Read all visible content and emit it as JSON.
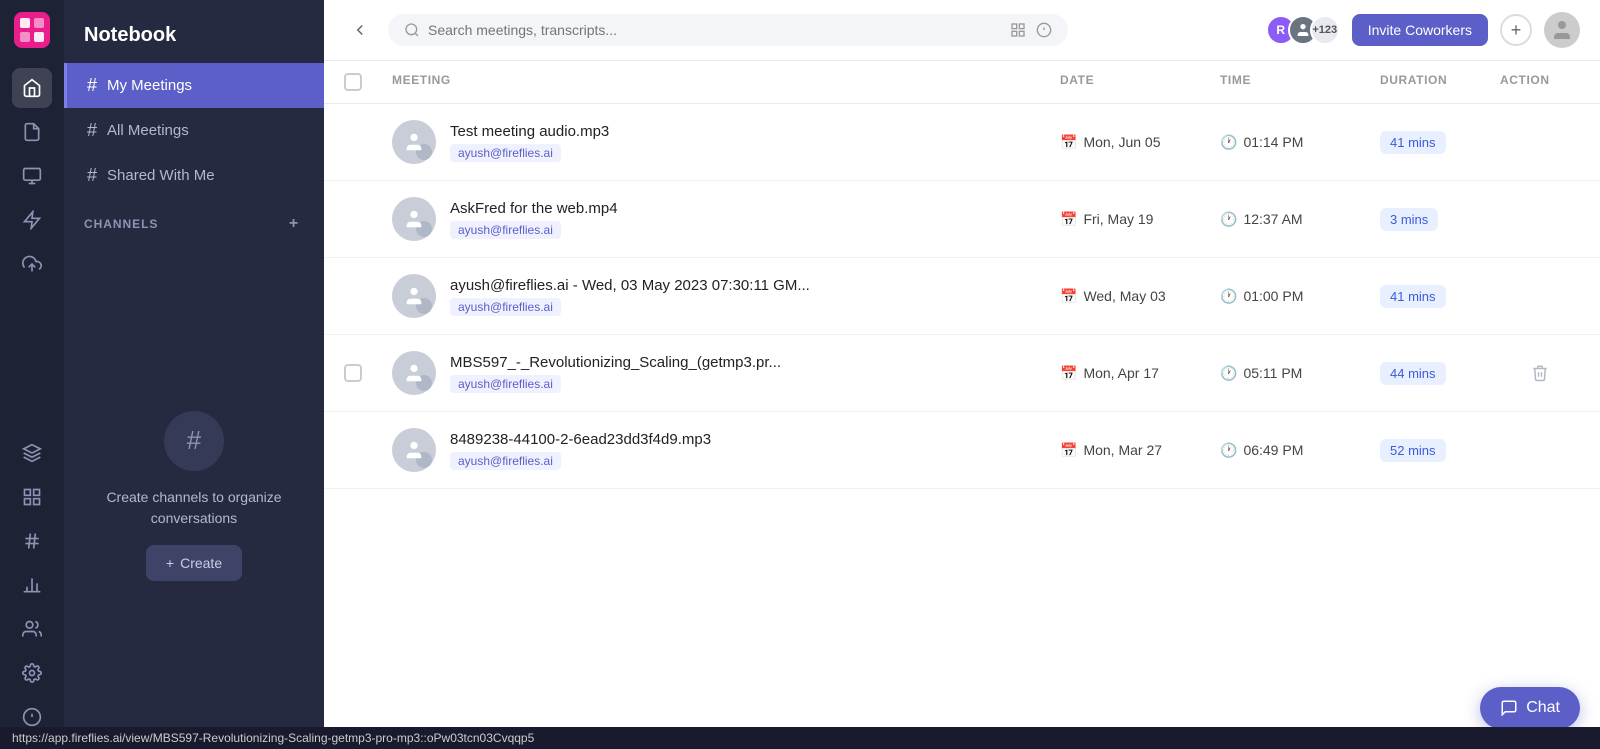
{
  "app": {
    "title": "Notebook"
  },
  "sidebar": {
    "title": "Notebook",
    "nav_items": [
      {
        "id": "home",
        "icon": "🏠"
      },
      {
        "id": "doc",
        "icon": "📄"
      },
      {
        "id": "chart",
        "icon": "📊"
      },
      {
        "id": "bolt",
        "icon": "⚡"
      },
      {
        "id": "upload",
        "icon": "⬆"
      },
      {
        "id": "layers",
        "icon": "🗂"
      },
      {
        "id": "grid",
        "icon": "⊞"
      },
      {
        "id": "hash",
        "icon": "#"
      },
      {
        "id": "bar-chart",
        "icon": "📶"
      }
    ],
    "bottom_nav": [
      {
        "id": "people",
        "icon": "👥"
      },
      {
        "id": "settings",
        "icon": "⚙"
      },
      {
        "id": "info",
        "icon": "ℹ"
      }
    ],
    "items": [
      {
        "id": "my-meetings",
        "label": "My Meetings",
        "active": true
      },
      {
        "id": "all-meetings",
        "label": "All Meetings",
        "active": false
      },
      {
        "id": "shared-with-me",
        "label": "Shared With Me",
        "active": false
      }
    ],
    "channels_label": "CHANNELS",
    "create_channel_title": "Create channels to organize conversations",
    "create_button_label": "Create"
  },
  "topbar": {
    "search_placeholder": "Search meetings, transcripts...",
    "invite_button_label": "Invite Coworkers",
    "avatar_count": "+123"
  },
  "table": {
    "headers": {
      "meeting": "MEETING",
      "date": "DATE",
      "time": "TIME",
      "duration": "DURATION",
      "action": "ACTION"
    },
    "rows": [
      {
        "id": "row-1",
        "title": "Test meeting audio.mp3",
        "tag": "ayush@fireflies.ai",
        "date": "Mon, Jun 05",
        "time": "01:14 PM",
        "duration": "41 mins",
        "has_checkbox": false,
        "has_delete": false
      },
      {
        "id": "row-2",
        "title": "AskFred for the web.mp4",
        "tag": "ayush@fireflies.ai",
        "date": "Fri, May 19",
        "time": "12:37 AM",
        "duration": "3 mins",
        "has_checkbox": false,
        "has_delete": false
      },
      {
        "id": "row-3",
        "title": "ayush@fireflies.ai - Wed, 03 May 2023 07:30:11 GM...",
        "tag": "ayush@fireflies.ai",
        "date": "Wed, May 03",
        "time": "01:00 PM",
        "duration": "41 mins",
        "has_checkbox": false,
        "has_delete": false
      },
      {
        "id": "row-4",
        "title": "MBS597_-_Revolutionizing_Scaling_(getmp3.pr...",
        "tag": "ayush@fireflies.ai",
        "date": "Mon, Apr 17",
        "time": "05:11 PM",
        "duration": "44 mins",
        "has_checkbox": true,
        "has_delete": true
      },
      {
        "id": "row-5",
        "title": "8489238-44100-2-6ead23dd3f4d9.mp3",
        "tag": "ayush@fireflies.ai",
        "date": "Mon, Mar 27",
        "time": "06:49 PM",
        "duration": "52 mins",
        "has_checkbox": false,
        "has_delete": false
      }
    ]
  },
  "chat": {
    "label": "Chat"
  },
  "status_bar": {
    "url": "https://app.fireflies.ai/view/MBS597-Revolutionizing-Scaling-getmp3-pro-mp3::oPw03tcn03Cvqqp5"
  }
}
